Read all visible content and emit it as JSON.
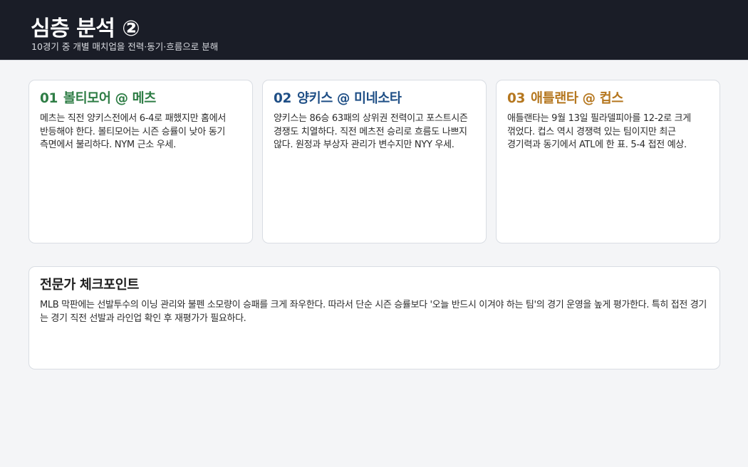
{
  "header": {
    "title": "심층 분석 ②",
    "subtitle": "10경기 중 개별 매치업을 전력·동기·흐름으로 분해"
  },
  "cards": [
    {
      "number": "01",
      "matchup": "볼티모어 @ 메츠",
      "color": "#2e7d45",
      "body": "메츠는 직전 양키스전에서 6-4로 패했지만 홈에서 반등해야 한다. 볼티모어는 시즌 승률이 낮아 동기 측면에서 불리하다. NYM 근소 우세."
    },
    {
      "number": "02",
      "matchup": "양키스 @ 미네소타",
      "color": "#1f4f86",
      "body": "양키스는 86승 63패의 상위권 전력이고 포스트시즌 경쟁도 치열하다. 직전 메츠전 승리로 흐름도 나쁘지 않다. 원정과 부상자 관리가 변수지만 NYY 우세."
    },
    {
      "number": "03",
      "matchup": "애틀랜타 @ 컵스",
      "color": "#b5771f",
      "body": "애틀랜타는 9월 13일 필라델피아를 12-2로 크게 꺾었다. 컵스 역시 경쟁력 있는 팀이지만 최근 경기력과 동기에서 ATL에 한 표. 5-4 접전 예상."
    }
  ],
  "expert": {
    "title": "전문가 체크포인트",
    "body": "MLB 막판에는 선발투수의 이닝 관리와 불펜 소모량이 승패를 크게 좌우한다. 따라서 단순 시즌 승률보다 '오늘 반드시 이겨야 하는 팀'의 경기 운영을 높게 평가한다. 특히 접전 경기는 경기 직전 선발과 라인업 확인 후 재평가가 필요하다."
  }
}
